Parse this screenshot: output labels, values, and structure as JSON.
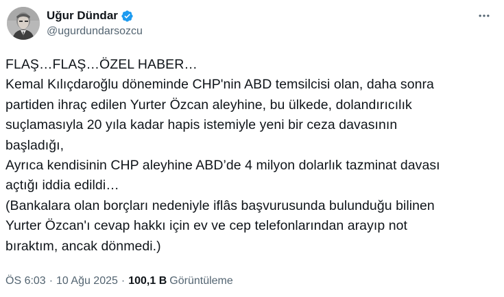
{
  "author": {
    "display_name": "Uğur Dündar",
    "handle": "@ugurdundarsozcu",
    "verified": true
  },
  "tweet": {
    "text": "FLAŞ…FLAŞ…ÖZEL HABER…\nKemal Kılıçdaroğlu döneminde CHP'nin ABD temsilcisi olan, daha sonra\npartiden ihraç edilen Yurter Özcan aleyhine, bu ülkede, dolandırıcılık\nsuçlamasıyla 20 yıla kadar hapis istemiyle yeni bir ceza davasının\nbaşladığı,\nAyrıca kendisinin CHP aleyhine ABD’de 4 milyon dolarlık tazminat davası\naçtığı iddia edildi…\n(Bankalara olan borçları nedeniyle iflâs başvurusunda bulunduğu bilinen\nYurter Özcan'ı cevap hakkı için ev ve cep telefonlarından arayıp not\nbıraktım, ancak dönmedi.)"
  },
  "meta": {
    "time": "ÖS 6:03",
    "separator": "·",
    "date": "10 Ağu 2025",
    "views_count": "100,1 B",
    "views_label": "Görüntüleme"
  },
  "icons": {
    "verified": "verified-badge-icon",
    "more": "more-horizontal-icon"
  },
  "colors": {
    "verified_blue": "#1d9bf0",
    "text_primary": "#0f1419",
    "text_secondary": "#536471"
  }
}
